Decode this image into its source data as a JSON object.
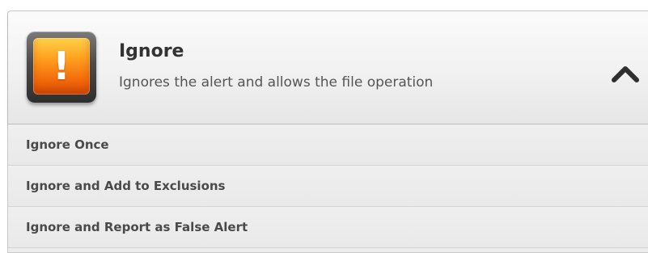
{
  "panel": {
    "title": "Ignore",
    "description": "Ignores the alert and allows the file operation",
    "icon": "warning-exclamation-icon",
    "icon_mark": "!",
    "collapse_icon": "chevron-up-icon",
    "accent_color": "#f58a12"
  },
  "options": [
    {
      "label": "Ignore Once"
    },
    {
      "label": "Ignore and Add to Exclusions"
    },
    {
      "label": "Ignore and Report as False Alert"
    }
  ]
}
